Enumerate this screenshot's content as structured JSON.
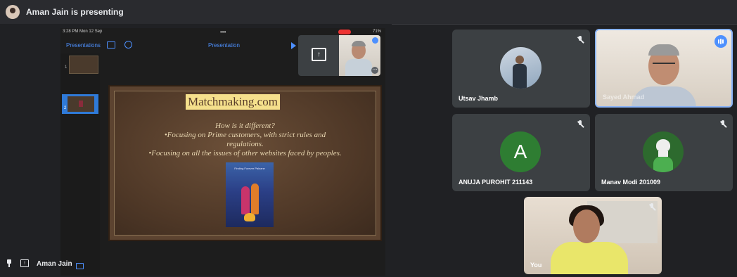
{
  "header": {
    "presenting_text": "Aman Jain is presenting"
  },
  "ipad": {
    "status_time": "3:28 PM  Mon 12 Sep",
    "status_dots": "•••",
    "status_battery": "71%",
    "toolbar_left": "Presentations",
    "toolbar_center": "Presentation",
    "thumbs": [
      "1",
      "2"
    ]
  },
  "slide": {
    "title": "Matchmaking.com",
    "lines": [
      "How is it different?",
      "•Focusing on Prime customers, with strict rules and",
      "regulations.",
      "•Focusing on all the issues of  other websites faced by peoples."
    ],
    "image_text": "Finding Forever Palsane"
  },
  "presenter": {
    "name": "Aman Jain"
  },
  "participants": [
    {
      "name": "Utsav Jhamb",
      "muted": true
    },
    {
      "name": "Sayed Ahmad",
      "muted": false,
      "speaking": true
    },
    {
      "name": "ANUJA PUROHIT 211143",
      "initial": "A",
      "muted": true
    },
    {
      "name": "Manav Modi 201009",
      "muted": true
    },
    {
      "name": "You",
      "muted": true
    }
  ],
  "colors": {
    "accent": "#4d90fe",
    "tile_bg": "#3c4043",
    "page_bg": "#202124",
    "speaking_border": "#8ab4f8",
    "anuja_avatar": "#2e7d32"
  }
}
